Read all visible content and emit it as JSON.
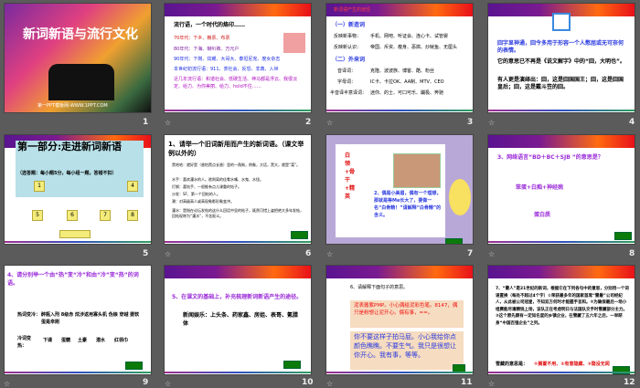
{
  "slides": [
    {
      "number": "1",
      "title": "新词新语与流行文化",
      "footer": "第一PPT模板网-WWW.1PPT.COM"
    },
    {
      "number": "2",
      "heading": "流行语，一个时代的烙印……",
      "lines": [
        "70年代：下乡、粮票、布票",
        "80年代：下海、喇叭裤、万元户",
        "90年代：下岗、炫耀、大哥大、泰坦尼克、度女杂志",
        "本世纪初流行语：911、茶社会、反恐、非典、入世",
        "近几年流行语：和谐社会、低碳生活、神马都是浮云、我很淡定、给力、为你美丽、给力、hold不住……"
      ]
    },
    {
      "number": "3",
      "header": "新词语产生的途径",
      "sec1": "（一）新造词",
      "r1l": "反映新事物：",
      "r1v": "手机、网吧、听证会、连心卡、试管婴",
      "r2l": "反映新认识：",
      "r2v": "帝国、斥资、瘦身、恶搞、炒鱿鱼、无厘头",
      "sec2": "（二）外来词",
      "r3l": "音译词：",
      "r3v": "克隆、波波族、博客、酷、粉丝",
      "r4l": "字母词：",
      "r4v": "IC卡、卡拉OK、AA制、MTV、CEO",
      "r5l": "半音译半意译词：",
      "r5v": "迷你、的士、可口可乐、蹦极、奔驰"
    },
    {
      "number": "4",
      "lines": [
        "囧字显神通，囧今多用于形容一个人憋屈或无可奈何的表情。",
        "它的意思已不再是《说文解字》中的“囧，大明也”。",
        "有人更是演绎出：囧，这是囧国国王；囧，这是囧国皇后；囧，这是戴斗笠的囧。"
      ]
    },
    {
      "number": "5",
      "title": "第一部分:走进新词新语",
      "sub": "（选答题：每小题5分，每小组一题，答错不扣）",
      "keys": [
        "1",
        "4",
        "5",
        "6",
        "7",
        "8"
      ]
    },
    {
      "number": "6",
      "title": "1、请举一个旧词新用而产生的新词语。（课文举例以外的）",
      "lines": [
        "黑哈哈：就好是（香怕黑点长香）里的一角狗，例象，大话，黑大，就是“菜”。",
        "水手：喜欢灌水的人。欲则离的佳肴水嘴、水鬼、水怪。",
        "打钢：喜钻手、一很推有点儿课重的钻子。",
        "沙发：SF、第一个回帖的人。",
        "潮：对高级高人或高现象影形象变冲。",
        "灌水：是指在论坛发帖的这什么回话中显的帖子，既然可惜上姿把绝大多年发帖，回帖现称为“灌水”，不含贬义。"
      ]
    },
    {
      "number": "7",
      "vertical": "白领+骨干+精英",
      "text": "2、偶是小美眉，偶有一个理想，那就是等Me长大了，要做一名“白骨精！”请解释“白骨精”的含义。"
    },
    {
      "number": "8",
      "q": "3、网络语言“BD＋BC＋SJB ”的意思是？",
      "a1": "笨蛋+白痴+神经病",
      "a2": "蛋白质"
    },
    {
      "number": "9",
      "title": "4、请分别举一个由“热”变“冷”和由“冷”变“热”的词语。",
      "hot_label": "热词变冷：",
      "hot": "醉瓶入刑 8级赤  炫涉返用寡头机  伪娘  穿越 婴软蛋是幸刚",
      "cold_label": "冷词变热：",
      "cold": [
        "下课",
        "蛋糖",
        "土豪",
        "潜水",
        "红领巾"
      ]
    },
    {
      "number": "10",
      "title": "5、在课文的基础上，补充梳理新词新语产生的途径。",
      "body": "新闻娱乐：上头条、药家鑫、房姐、表哥、氪腊体"
    },
    {
      "number": "11",
      "title": "6、请解释下面句子的意思。",
      "red": "泥表酱紫PMP。小心偶给泥彩色笔。8147，偶只是粉想让泥开心。偶有事，==。",
      "blue": "你不要这样子拍马屁。小心我给你点颜色瞧瞧。不要生气。我只是很想让你开心。我有事，等等。"
    },
    {
      "number": "12",
      "body": "7、“雷人”是21世纪的新词，根据它在下列各句中的意思，分别用一个词语置换（每处不超过4个字）①荣获最多年的国家首席“雷最”公司经纪人，从此被公司冠星，不知双方何时才能握手言和。②为确保最后一场小组赛能尽遣精锐上场，该队正在考虑明日与法国队交手时雪藏部分主力。③这个原先颇有一定知名度的乡镇企业，在雪藏了五六年之后，一举跻身“中国百强企业”之列。",
      "ans_label": "雪藏的意思是：",
      "ans": "①搁置不用、②有意隐藏、③隐没无闻"
    }
  ],
  "colors": {
    "purple": "#9a2ad8",
    "blue": "#1a2ae0",
    "red": "#e01010",
    "green": "#0a7a0a"
  }
}
